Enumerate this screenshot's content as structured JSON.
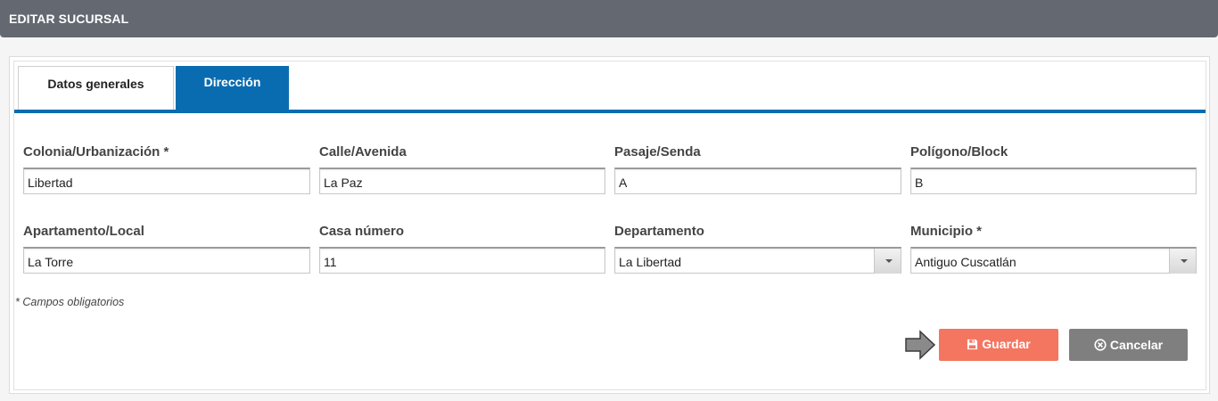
{
  "header": {
    "title": "EDITAR SUCURSAL"
  },
  "tabs": [
    {
      "label": "Datos generales",
      "active": false
    },
    {
      "label": "Dirección",
      "active": true
    }
  ],
  "form": {
    "colonia": {
      "label": "Colonia/Urbanización *",
      "value": "Libertad"
    },
    "calle": {
      "label": "Calle/Avenida",
      "value": "La Paz"
    },
    "pasaje": {
      "label": "Pasaje/Senda",
      "value": "A"
    },
    "poligono": {
      "label": "Polígono/Block",
      "value": "B"
    },
    "apartamento": {
      "label": "Apartamento/Local",
      "value": "La Torre"
    },
    "casa": {
      "label": "Casa número",
      "value": "11"
    },
    "departamento": {
      "label": "Departamento",
      "value": "La Libertad"
    },
    "municipio": {
      "label": "Municipio *",
      "value": "Antiguo Cuscatlán"
    }
  },
  "note": "* Campos obligatorios",
  "actions": {
    "save_label": "Guardar",
    "cancel_label": "Cancelar"
  },
  "colors": {
    "header": "#636871",
    "accent": "#0a6cb0",
    "save": "#f47560",
    "cancel": "#7f7f7f"
  },
  "icons": {
    "save": "floppy-disk-icon",
    "cancel": "times-circle-icon",
    "pointer": "arrow-right-icon"
  }
}
